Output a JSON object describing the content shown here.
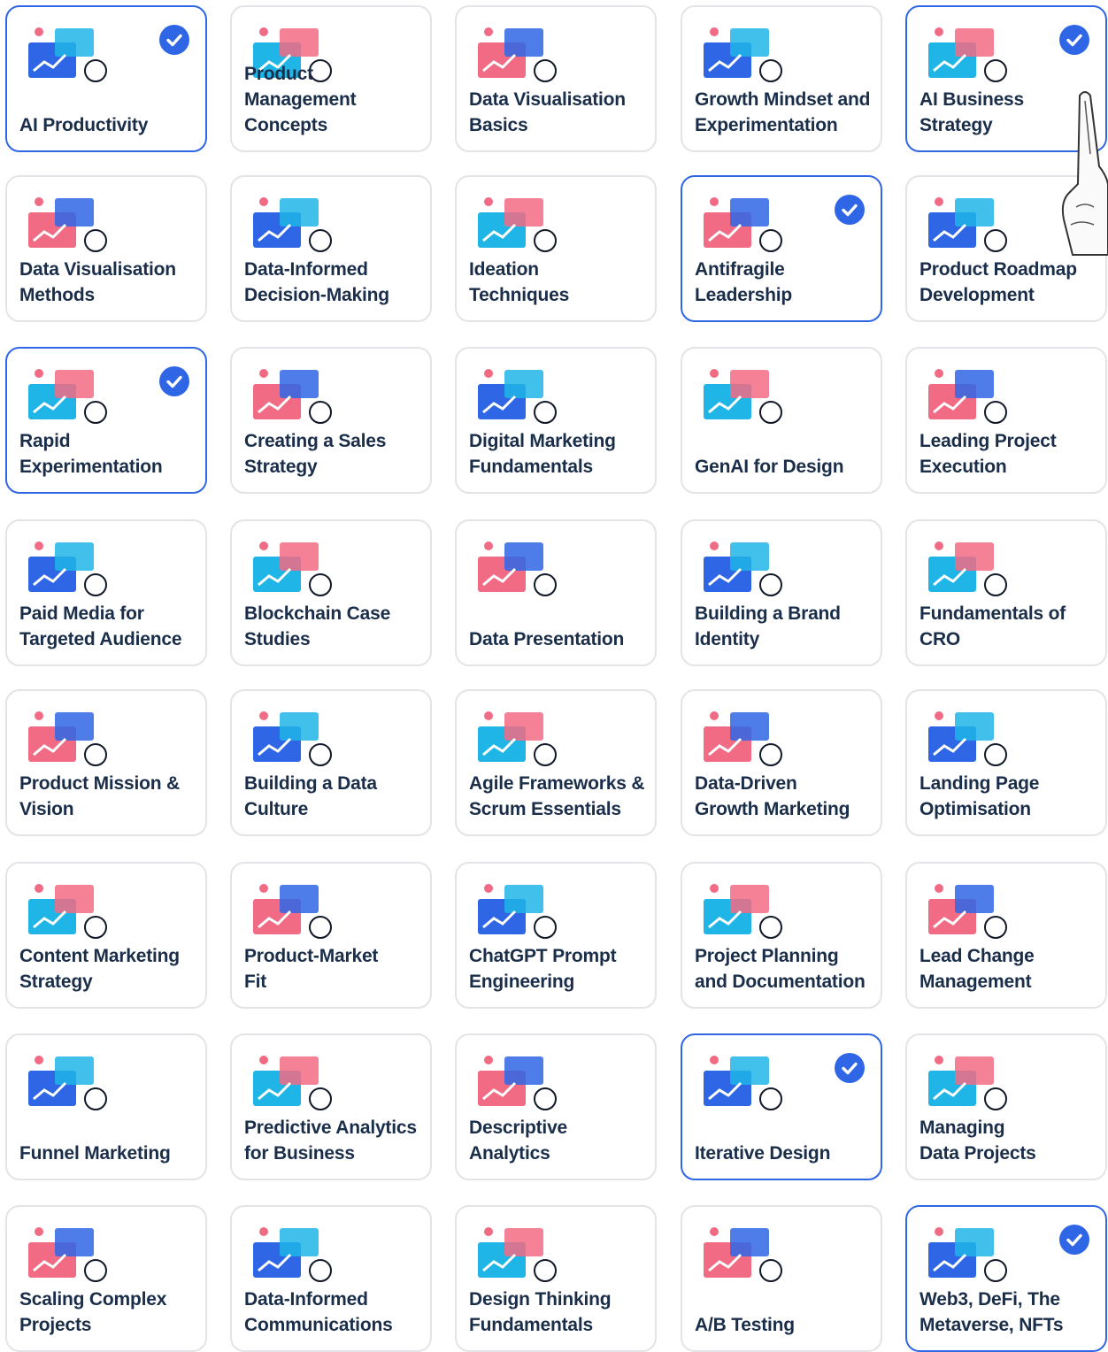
{
  "accent_color": "#2f66e6",
  "courses": [
    {
      "title": "AI Productivity",
      "selected": true,
      "icon": "alarm-clock-calendar-icon"
    },
    {
      "title": "Product Management\nConcepts",
      "selected": false,
      "icon": "gear-box-icon"
    },
    {
      "title": "Data Visualisation\nBasics",
      "selected": false,
      "icon": "chart-flag-icon"
    },
    {
      "title": "Growth Mindset and\nExperimentation",
      "selected": false,
      "icon": "flask-graph-icon"
    },
    {
      "title": "AI Business\nStrategy",
      "selected": true,
      "icon": "brain-gear-icon"
    },
    {
      "title": "Data Visualisation\nMethods",
      "selected": false,
      "icon": "chart-screens-icon"
    },
    {
      "title": "Data-Informed\nDecision-Making",
      "selected": false,
      "icon": "split-arrows-icon"
    },
    {
      "title": "Ideation\nTechniques",
      "selected": false,
      "icon": "lightbulb-tiles-icon"
    },
    {
      "title": "Antifragile\nLeadership",
      "selected": true,
      "icon": "pillars-icon"
    },
    {
      "title": "Product Roadmap\nDevelopment",
      "selected": false,
      "icon": "roadmap-pins-icon"
    },
    {
      "title": "Rapid\nExperimentation",
      "selected": true,
      "icon": "flask-burst-icon"
    },
    {
      "title": "Creating a Sales\nStrategy",
      "selected": false,
      "icon": "euro-arrow-up-icon"
    },
    {
      "title": "Digital Marketing\nFundamentals",
      "selected": false,
      "icon": "megaphone-monitor-icon"
    },
    {
      "title": "GenAI for Design",
      "selected": false,
      "icon": "design-doc-icon"
    },
    {
      "title": "Leading Project\nExecution",
      "selected": false,
      "icon": "presentation-board-icon"
    },
    {
      "title": "Paid Media for\nTargeted Audience",
      "selected": false,
      "icon": "money-target-icon"
    },
    {
      "title": "Blockchain Case\nStudies",
      "selected": false,
      "icon": "magnifier-cube-icon"
    },
    {
      "title": "Data Presentation",
      "selected": false,
      "icon": "audience-board-icon"
    },
    {
      "title": "Building a Brand\nIdentity",
      "selected": false,
      "icon": "brand-palette-icon"
    },
    {
      "title": "Fundamentals of\nCRO",
      "selected": false,
      "icon": "laptop-pyramid-icon"
    },
    {
      "title": "Product Mission &\nVision",
      "selected": false,
      "icon": "set-square-icon"
    },
    {
      "title": "Building a Data\nCulture",
      "selected": false,
      "icon": "network-nodes-icon"
    },
    {
      "title": "Agile Frameworks &\nScrum Essentials",
      "selected": false,
      "icon": "team-cycle-icon"
    },
    {
      "title": "Data-Driven\nGrowth Marketing",
      "selected": false,
      "icon": "pie-rocket-icon"
    },
    {
      "title": "Landing Page\nOptimisation",
      "selected": false,
      "icon": "monitor-target-icon"
    },
    {
      "title": "Content Marketing\nStrategy",
      "selected": false,
      "icon": "phone-content-icon"
    },
    {
      "title": "Product-Market\nFit",
      "selected": false,
      "icon": "pen-arc-gears-icon"
    },
    {
      "title": "ChatGPT Prompt\nEngineering",
      "selected": false,
      "icon": "chatgpt-window-icon"
    },
    {
      "title": "Project Planning\nand Documentation",
      "selected": false,
      "icon": "calendar-checklist-icon"
    },
    {
      "title": "Lead Change\nManagement",
      "selected": false,
      "icon": "chess-king-bars-icon"
    },
    {
      "title": "Funnel Marketing",
      "selected": false,
      "icon": "funnel-magnet-icon"
    },
    {
      "title": "Predictive Analytics\nfor Business",
      "selected": false,
      "icon": "org-chart-icon"
    },
    {
      "title": "Descriptive\nAnalytics",
      "selected": false,
      "icon": "stacked-bars-icon"
    },
    {
      "title": "Iterative Design",
      "selected": true,
      "icon": "pen-nib-curve-icon"
    },
    {
      "title": "Managing\nData Projects",
      "selected": false,
      "icon": "magnifier-growth-icon"
    },
    {
      "title": "Scaling Complex\nProjects",
      "selected": false,
      "icon": "magnifier-blocks-icon"
    },
    {
      "title": "Data-Informed\nCommunications",
      "selected": false,
      "icon": "chat-bubbles-graph-icon"
    },
    {
      "title": "Design Thinking\nFundamentals",
      "selected": false,
      "icon": "squiggle-arrow-icon"
    },
    {
      "title": "A/B Testing",
      "selected": false,
      "icon": "ab-split-icon"
    },
    {
      "title": "Web3, DeFi, The\nMetaverse, NFTs",
      "selected": true,
      "icon": "cube-cluster-icon"
    }
  ]
}
